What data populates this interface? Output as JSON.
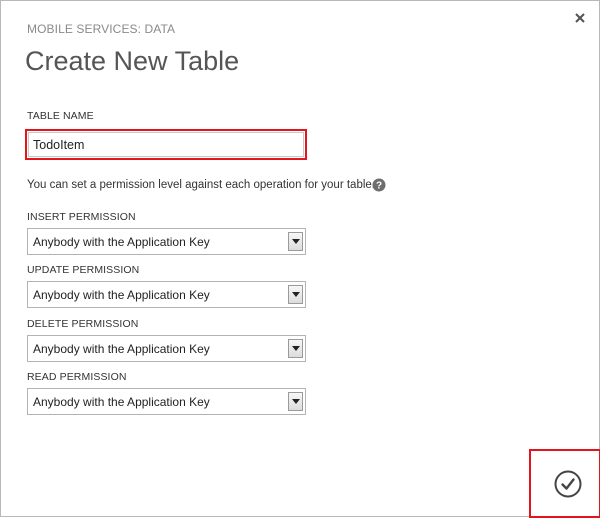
{
  "dialog": {
    "subtitle": "MOBILE SERVICES: DATA",
    "title": "Create New Table",
    "close_icon": "close-icon",
    "confirm_icon": "checkmark-circle-icon",
    "highlight_color": "#e2141c"
  },
  "table_name": {
    "label": "TABLE NAME",
    "value": "TodoItem"
  },
  "permissions": {
    "description": "You can set a permission level against each operation for your table.",
    "help_icon": "help-icon",
    "insert": {
      "label": "INSERT PERMISSION",
      "value": "Anybody with the Application Key"
    },
    "update": {
      "label": "UPDATE PERMISSION",
      "value": "Anybody with the Application Key"
    },
    "delete": {
      "label": "DELETE PERMISSION",
      "value": "Anybody with the Application Key"
    },
    "read": {
      "label": "READ PERMISSION",
      "value": "Anybody with the Application Key"
    }
  }
}
